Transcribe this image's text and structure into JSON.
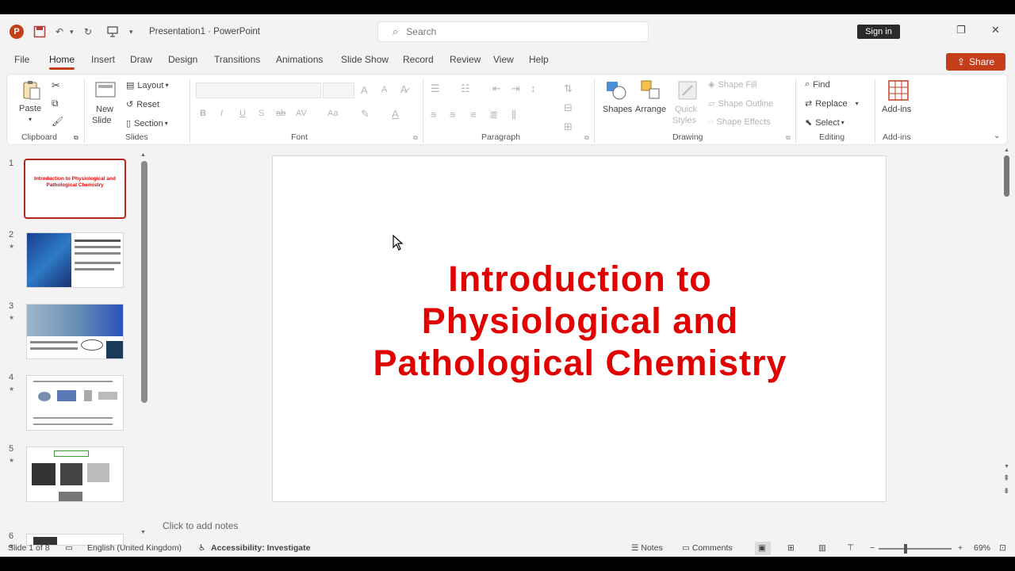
{
  "titlebar": {
    "app_icon": "powerpoint-logo",
    "doc_title": "Presentation1 · PowerPoint",
    "search_placeholder": "Search",
    "signin_label": "Sign in"
  },
  "tabs": [
    "File",
    "Home",
    "Insert",
    "Draw",
    "Design",
    "Transitions",
    "Animations",
    "Slide Show",
    "Record",
    "Review",
    "View",
    "Help"
  ],
  "active_tab": "Home",
  "share_label": "Share",
  "ribbon": {
    "clipboard": {
      "paste": "Paste",
      "label": "Clipboard"
    },
    "slides": {
      "new_slide": "New",
      "new_slide_2": "Slide",
      "layout": "Layout",
      "reset": "Reset",
      "section": "Section",
      "label": "Slides"
    },
    "font": {
      "label": "Font",
      "bold": "B",
      "italic": "I",
      "underline": "U",
      "strike": "S",
      "ab": "ab",
      "av": "AV",
      "aa": "Aa",
      "a_up": "A",
      "a_down": "A",
      "a_color": "A"
    },
    "paragraph": {
      "label": "Paragraph"
    },
    "drawing": {
      "shapes": "Shapes",
      "arrange": "Arrange",
      "quick": "Quick",
      "styles": "Styles",
      "shape_fill": "Shape Fill",
      "shape_outline": "Shape Outline",
      "shape_effects": "Shape Effects",
      "label": "Drawing"
    },
    "editing": {
      "find": "Find",
      "replace": "Replace",
      "select": "Select",
      "label": "Editing"
    },
    "addins": {
      "addins": "Add-ins",
      "label": "Add-ins"
    }
  },
  "thumbnails": [
    {
      "num": "1",
      "title": "Introduction to Physiological and Pathological Chemistry"
    },
    {
      "num": "2"
    },
    {
      "num": "3"
    },
    {
      "num": "4"
    },
    {
      "num": "5"
    },
    {
      "num": "6"
    }
  ],
  "slide": {
    "title_line1": "Introduction to",
    "title_line2": "Physiological and",
    "title_line3": "Pathological Chemistry",
    "title_color": "#e00000"
  },
  "notes_placeholder": "Click to add notes",
  "status": {
    "slide_count": "Slide 1 of 8",
    "language": "English (United Kingdom)",
    "accessibility": "Accessibility: Investigate",
    "notes": "Notes",
    "comments": "Comments",
    "zoom": "69%"
  },
  "colors": {
    "accent": "#c43e1c"
  }
}
